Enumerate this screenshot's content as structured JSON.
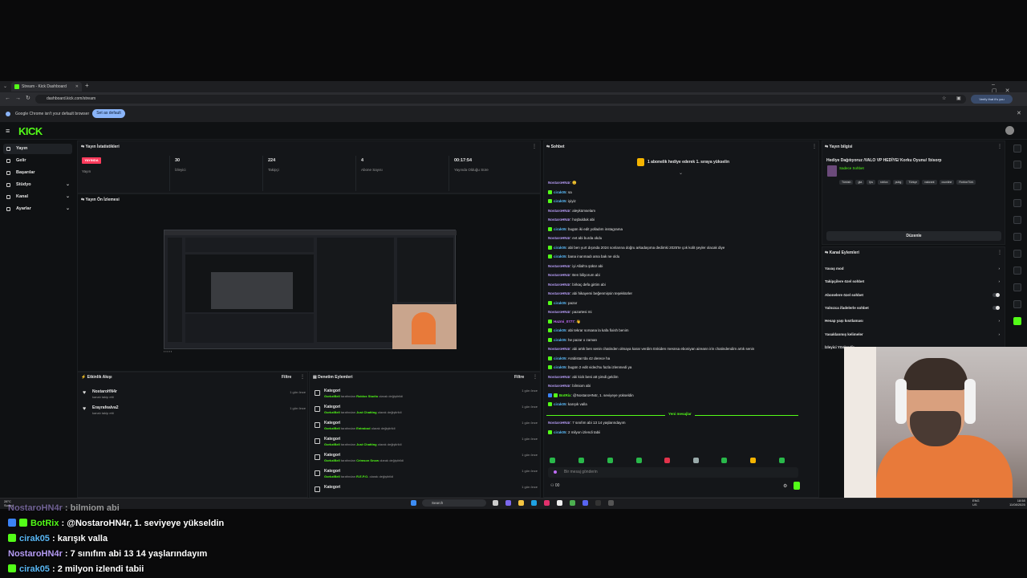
{
  "browser": {
    "tab_title": "Stream - Kick Dashboard",
    "url": "dashboard.kick.com/stream",
    "profile_label": "Verify that it's you",
    "infobar_text": "Google Chrome isn't your default browser",
    "infobar_button": "Set as default"
  },
  "app": {
    "logo": "KICK"
  },
  "sidebar": {
    "items": [
      {
        "label": "Yayın",
        "icon": "broadcast-icon"
      },
      {
        "label": "Gelir",
        "icon": "money-icon"
      },
      {
        "label": "Başarılar",
        "icon": "trophy-icon"
      },
      {
        "label": "Stüdyo",
        "icon": "studio-icon"
      },
      {
        "label": "Kanal",
        "icon": "channel-icon"
      },
      {
        "label": "Ayarlar",
        "icon": "settings-icon"
      }
    ]
  },
  "stats": {
    "title": "Yayın İstatistikleri",
    "live_badge": "YAYINDA",
    "live_label": "Yayın",
    "items": [
      {
        "value": "30",
        "label": "İzleyici"
      },
      {
        "value": "224",
        "label": "Takipçi"
      },
      {
        "value": "4",
        "label": "Abone Sayısı"
      },
      {
        "value": "00:17:54",
        "label": "Yayında Olduğu Süre"
      }
    ]
  },
  "preview": {
    "title": "Yayın Ön İzlemesi"
  },
  "activity": {
    "title": "Etkinlik Akışı",
    "filter": "Filtre",
    "items": [
      {
        "name": "NostaroHN4r",
        "desc": "kanalı takip etti",
        "time": "1 gün önce"
      },
      {
        "name": "Erayrafealva2",
        "desc": "kanalı takip etti",
        "time": "1 gün önce"
      }
    ]
  },
  "moderation": {
    "title": "Denetim Eylemleri",
    "filter": "Filtre",
    "items": [
      {
        "k": "Kategori",
        "by": "GorkziBell",
        "mid": "tarafından",
        "val": "Roblox Studio",
        "end": "olarak değiştirildi",
        "time": "1 gün önce"
      },
      {
        "k": "Kategori",
        "by": "GorkziBell",
        "mid": "tarafından",
        "val": "Just Chatting",
        "end": "olarak değiştirildi",
        "time": "1 gün önce"
      },
      {
        "k": "Kategori",
        "by": "GorkziBell",
        "mid": "tarafından",
        "val": "Entrabod",
        "end": "olarak değiştirildi",
        "time": "1 gün önce"
      },
      {
        "k": "Kategori",
        "by": "GorkziBell",
        "mid": "tarafından",
        "val": "Just Chatting",
        "end": "olarak değiştirildi",
        "time": "1 gün önce"
      },
      {
        "k": "Kategori",
        "by": "GorkziBell",
        "mid": "tarafından",
        "val": "Crimson Snow",
        "end": "olarak değiştirildi",
        "time": "1 gün önce"
      },
      {
        "k": "Kategori",
        "by": "GorkziBell",
        "mid": "tarafından",
        "val": "R.E.P.O.",
        "end": "olarak değiştirildi",
        "time": "1 gün önce"
      },
      {
        "k": "Kategori",
        "by": "",
        "mid": "",
        "val": "",
        "end": "",
        "time": "1 gün önce"
      }
    ]
  },
  "chat": {
    "title": "Sohbet",
    "pinned": "1 abonelik hediye ederek 1. sıraya yükselin",
    "new_messages": "Yeni mesajlar",
    "input_placeholder": "Bir mesaj gönderin",
    "counter": "00",
    "messages": [
      {
        "user": "NostaroHN4r",
        "cls": "u-n",
        "badge": "",
        "text": ": 😊"
      },
      {
        "user": "cirak05",
        "cls": "u-c",
        "badge": "g",
        "text": ": sa"
      },
      {
        "user": "cirak05",
        "cls": "u-c",
        "badge": "g",
        "text": ": iyiyiz"
      },
      {
        "user": "NostaroHN4r",
        "cls": "u-n",
        "badge": "",
        "text": ": aleykümselam"
      },
      {
        "user": "NostaroHN4r",
        "cls": "u-n",
        "badge": "",
        "text": ": hoşbulduk abi"
      },
      {
        "user": "cirak05",
        "cls": "u-c",
        "badge": "g",
        "text": ": bugün iki edit yolladım instagrama"
      },
      {
        "user": "NostaroHN4r",
        "cls": "u-n",
        "badge": "",
        "text": ": evt abi burda okdu"
      },
      {
        "user": "cirak05",
        "cls": "u-c",
        "badge": "g",
        "text": ": abi ben yurt dışında 2024 sonlarına doğru arkadaşıma dedimki 2025'te çok kolit şeyler olacak diye"
      },
      {
        "user": "cirak05",
        "cls": "u-c",
        "badge": "g",
        "text": ": bana inanmadı ama bak ne oldu"
      },
      {
        "user": "NostaroHN4r",
        "cls": "u-n",
        "badge": "",
        "text": ": iyi Allah'a şükür abi"
      },
      {
        "user": "NostaroHN4r",
        "cls": "u-n",
        "badge": "",
        "text": ": Ben biliyorum abi"
      },
      {
        "user": "NostaroHN4r",
        "cls": "u-n",
        "badge": "",
        "text": ": birkaç defa girtim abi"
      },
      {
        "user": "NostaroHN4r",
        "cls": "u-n",
        "badge": "",
        "text": ": abi hikayemi beğenmişsin teşekkürler"
      },
      {
        "user": "cirak05",
        "cls": "u-c",
        "badge": "g",
        "text": ": pazar"
      },
      {
        "user": "NostaroHN4r",
        "cls": "u-n",
        "badge": "",
        "text": ": pazartesi mi"
      },
      {
        "user": "Hazmi_0777",
        "cls": "u-k",
        "badge": "g",
        "text": ": 👋"
      },
      {
        "user": "cirak05",
        "cls": "u-c",
        "badge": "g",
        "text": ": abi tekrar sorsana la kafa fixish benim"
      },
      {
        "user": "cirak05",
        "cls": "u-c",
        "badge": "g",
        "text": ": he pazar o zaman"
      },
      {
        "user": "NostaroHN4r",
        "cls": "u-n",
        "badge": "",
        "text": ": abi artık ben senin chatinden olmaya karar verdim Eskiden mesnsa eboniyan aireann irin chatindendim artık senin"
      },
      {
        "user": "cirak05",
        "cls": "u-c",
        "badge": "g",
        "text": ": Arabistan'da 42 derece ha"
      },
      {
        "user": "cirak05",
        "cls": "u-c",
        "badge": "g",
        "text": ": bugün 2 edit vided'su fazla izlenmedi ya"
      },
      {
        "user": "NostaroHN4r",
        "cls": "u-n",
        "badge": "",
        "text": ": abi kick beni att şimdi geldim"
      },
      {
        "user": "NostaroHN4r",
        "cls": "u-n",
        "badge": "",
        "text": ": bilmiom abi"
      },
      {
        "user": "BotRix",
        "cls": "u-b",
        "badge": "b",
        "text": ": @NostaroHN4r, 1. seviyeye yükseldin"
      },
      {
        "user": "cirak05",
        "cls": "u-c",
        "badge": "g",
        "text": ": karışık valla"
      }
    ],
    "after_new": [
      {
        "user": "NostaroHN4r",
        "cls": "u-n",
        "badge": "",
        "text": ": 7 sınıfım abi 13 14 yaşlarındayım"
      },
      {
        "user": "cirak05",
        "cls": "u-c",
        "badge": "g",
        "text": ": 2 milyon izlendi tabii"
      }
    ]
  },
  "stream_info": {
    "title": "Yayın bilgisi",
    "stream_title": "Hediye Dağıtıyoruz /VALO VP HEDİYE/ Korku Oyunu/ !bisorp",
    "category": "Sadece Sohbet",
    "tags": [
      "Türkish",
      "gta",
      "fps",
      "roblox",
      "pubg",
      "Türkçe",
      "valorant",
      "csonline",
      "RobloxTürk"
    ],
    "edit_button": "Düzenle"
  },
  "channel_actions": {
    "title": "Kanal Eylemleri",
    "items": [
      {
        "label": "Yavaş mod",
        "control": "chevron"
      },
      {
        "label": "Takipçilere özel sohbet",
        "control": "chevron"
      },
      {
        "label": "Abonelere özel sohbet",
        "control": "toggle"
      },
      {
        "label": "Yalnızca ifadelerle sohbet",
        "control": "toggle"
      },
      {
        "label": "Hesap yaşı kısıtlaması",
        "control": "chevron"
      },
      {
        "label": "Yasaklanmış kelimeler",
        "control": "chevron"
      },
      {
        "label": "İzleyici Yönlendir",
        "control": ""
      }
    ]
  },
  "taskbar": {
    "weather_temp": "28°C",
    "weather_desc": "Sunny",
    "search_placeholder": "Search",
    "lang": "ENG",
    "region": "US",
    "time": "18:58",
    "date": "11/08/2025"
  },
  "overlay_chat": [
    {
      "user": "NostaroHN4r",
      "cls": "u-n",
      "badge": "",
      "text": " : bilmiom abi"
    },
    {
      "user": "BotRix",
      "cls": "u-b",
      "badge": "b",
      "text": " : @NostaroHN4r, 1. seviyeye yükseldin"
    },
    {
      "user": "cirak05",
      "cls": "u-c",
      "badge": "g",
      "text": " : karışık valla"
    },
    {
      "user": "NostaroHN4r",
      "cls": "u-n",
      "badge": "",
      "text": " : 7 sınıfım abi 13 14 yaşlarındayım"
    },
    {
      "user": "cirak05",
      "cls": "u-c",
      "badge": "g",
      "text": " : 2 milyon izlendi tabii"
    }
  ],
  "colors": {
    "accent": "#53fc18",
    "live": "#ff3b5c",
    "bg": "#0f1113"
  }
}
